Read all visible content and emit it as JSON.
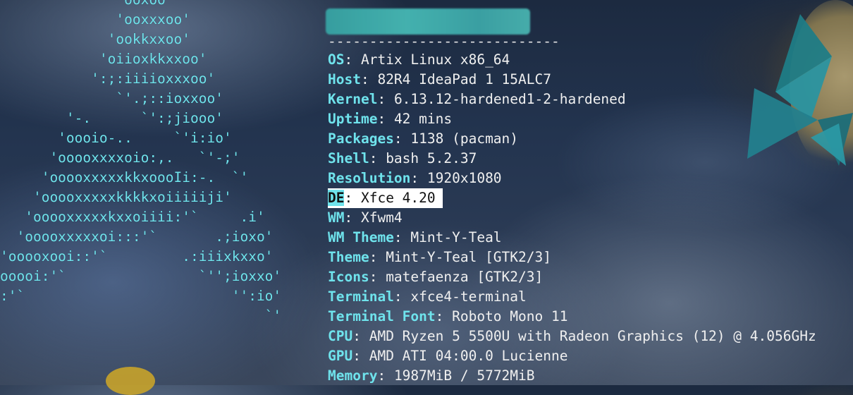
{
  "ascii_logo": {
    "color": "#6fe3ec",
    "lines": [
      "               ooxoo",
      "              'ooxxxoo'",
      "             'ookkxxoo'",
      "            'oiioxkkxxoo'",
      "           ':;:iiiioxxxoo'",
      "              `'.;::ioxxoo'",
      "        '-.      `':;jiooo'",
      "       'oooio-..     `'i:io'",
      "      'ooooxxxxoio:,.   `'-;'",
      "     'ooooxxxxxkkxoooIi:-.  `'",
      "    'ooooxxxxxkkkkxoiiiiiji'",
      "   'ooooxxxxxkxxoiiii:'`     .i'",
      "  'ooooxxxxxoi:::'`       .;ioxo'",
      "'ooooxooi::'`         .:iiixkxxo'",
      "ooooi:'`                `'';ioxxo'",
      ":'`                         '':io'",
      "                                `'"
    ]
  },
  "title": {
    "blurred": true,
    "color": "#3ea9a9"
  },
  "separator": "----------------------------",
  "colors": {
    "key": "#6fe3ec",
    "value": "#f0f0f0",
    "highlight_bg": "#ffffff"
  },
  "info": [
    {
      "key": "OS",
      "value": "Artix Linux x86_64"
    },
    {
      "key": "Host",
      "value": "82R4 IdeaPad 1 15ALC7"
    },
    {
      "key": "Kernel",
      "value": "6.13.12-hardened1-2-hardened"
    },
    {
      "key": "Uptime",
      "value": "42 mins"
    },
    {
      "key": "Packages",
      "value": "1138 (pacman)"
    },
    {
      "key": "Shell",
      "value": "bash 5.2.37"
    },
    {
      "key": "Resolution",
      "value": "1920x1080"
    },
    {
      "key": "DE",
      "value": "Xfce 4.20",
      "highlighted": true
    },
    {
      "key": "WM",
      "value": "Xfwm4"
    },
    {
      "key": "WM Theme",
      "value": "Mint-Y-Teal"
    },
    {
      "key": "Theme",
      "value": "Mint-Y-Teal [GTK2/3]"
    },
    {
      "key": "Icons",
      "value": "matefaenza [GTK2/3]"
    },
    {
      "key": "Terminal",
      "value": "xfce4-terminal"
    },
    {
      "key": "Terminal Font",
      "value": "Roboto Mono 11"
    },
    {
      "key": "CPU",
      "value": "AMD Ryzen 5 5500U with Radeon Graphics (12) @ 4.056GHz"
    },
    {
      "key": "GPU",
      "value": "AMD ATI 04:00.0 Lucienne"
    },
    {
      "key": "Memory",
      "value": "1987MiB / 5772MiB"
    }
  ]
}
